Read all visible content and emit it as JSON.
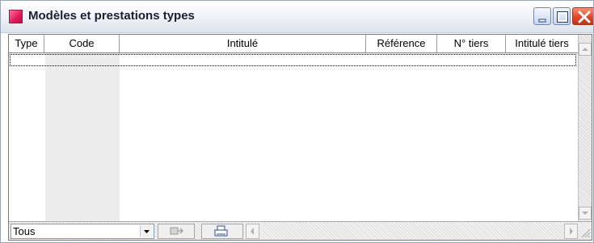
{
  "window": {
    "title": "Modèles et prestations types",
    "icon": "app-window-icon",
    "buttons": [
      "minimize-icon",
      "maximize-icon",
      "close-icon"
    ]
  },
  "grid": {
    "columns": [
      "Type",
      "Code",
      "Intitulé",
      "Référence",
      "N° tiers",
      "Intitulé tiers"
    ]
  },
  "footer": {
    "filter_value": "Tous",
    "export_icon": "export-icon",
    "print_icon": "print-icon"
  },
  "colors": {
    "accent": "#e01a5a",
    "close": "#e0472a"
  }
}
